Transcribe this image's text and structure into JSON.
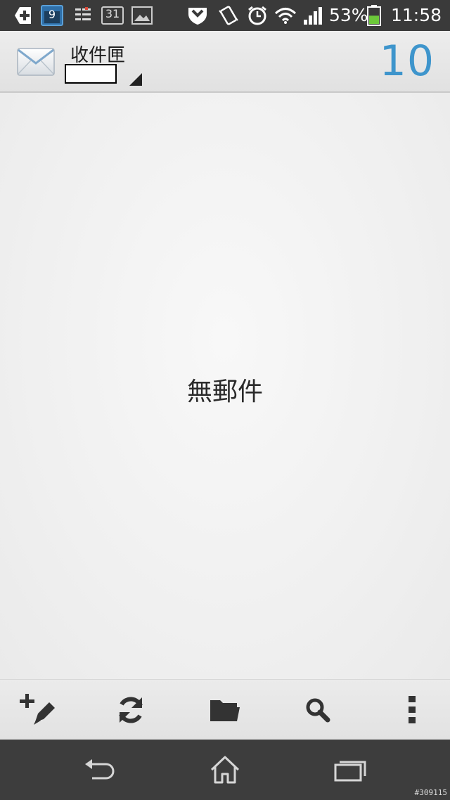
{
  "status_bar": {
    "calendar_day": "9",
    "date_badge": "31",
    "battery_percent": "53%",
    "time": "11:58",
    "battery_level": 0.53,
    "icons": [
      "add-notification-icon",
      "calendar-icon",
      "task-list-icon",
      "date-icon",
      "gallery-icon",
      "shield-icon",
      "vibrate-icon",
      "alarm-icon",
      "wifi-icon",
      "signal-icon",
      "battery-icon"
    ]
  },
  "header": {
    "folder": "收件匣",
    "unread_count": "10",
    "accent_color": "#3e95cc"
  },
  "main": {
    "empty_message": "無郵件"
  },
  "toolbar": {
    "icons": [
      "compose-icon",
      "refresh-icon",
      "folder-icon",
      "search-icon",
      "more-icon"
    ]
  },
  "nav_bar": {
    "icons": [
      "back-icon",
      "home-icon",
      "recent-apps-icon"
    ]
  },
  "watermark": "#309115"
}
